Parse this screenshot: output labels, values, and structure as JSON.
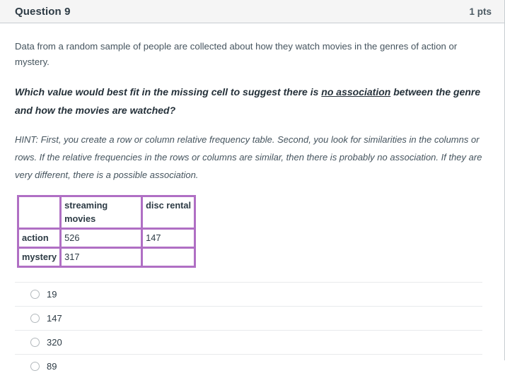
{
  "header": {
    "title": "Question 9",
    "points": "1 pts"
  },
  "body": {
    "intro": "Data from a random sample of people are collected about how they watch movies in the genres of action or mystery.",
    "question_before": "Which value would best fit in the missing cell to suggest there is ",
    "question_underlined": "no association",
    "question_after": " between the genre and how the movies are watched?",
    "hint": "HINT:  First, you create a row or column relative frequency table. Second, you look for similarities in the columns or rows. If the relative frequencies in the rows or columns are similar, then there is probably no association. If they are very different, there is a possible association."
  },
  "table": {
    "border_color": "#b06fc4",
    "corner_label": "",
    "column_headers": [
      "streaming movies",
      "disc rental"
    ],
    "rows": [
      {
        "label": "action",
        "cells": [
          "526",
          "147"
        ]
      },
      {
        "label": "mystery",
        "cells": [
          "317",
          ""
        ]
      }
    ]
  },
  "answers": [
    {
      "label": "19"
    },
    {
      "label": "147"
    },
    {
      "label": "320"
    },
    {
      "label": "89"
    }
  ]
}
